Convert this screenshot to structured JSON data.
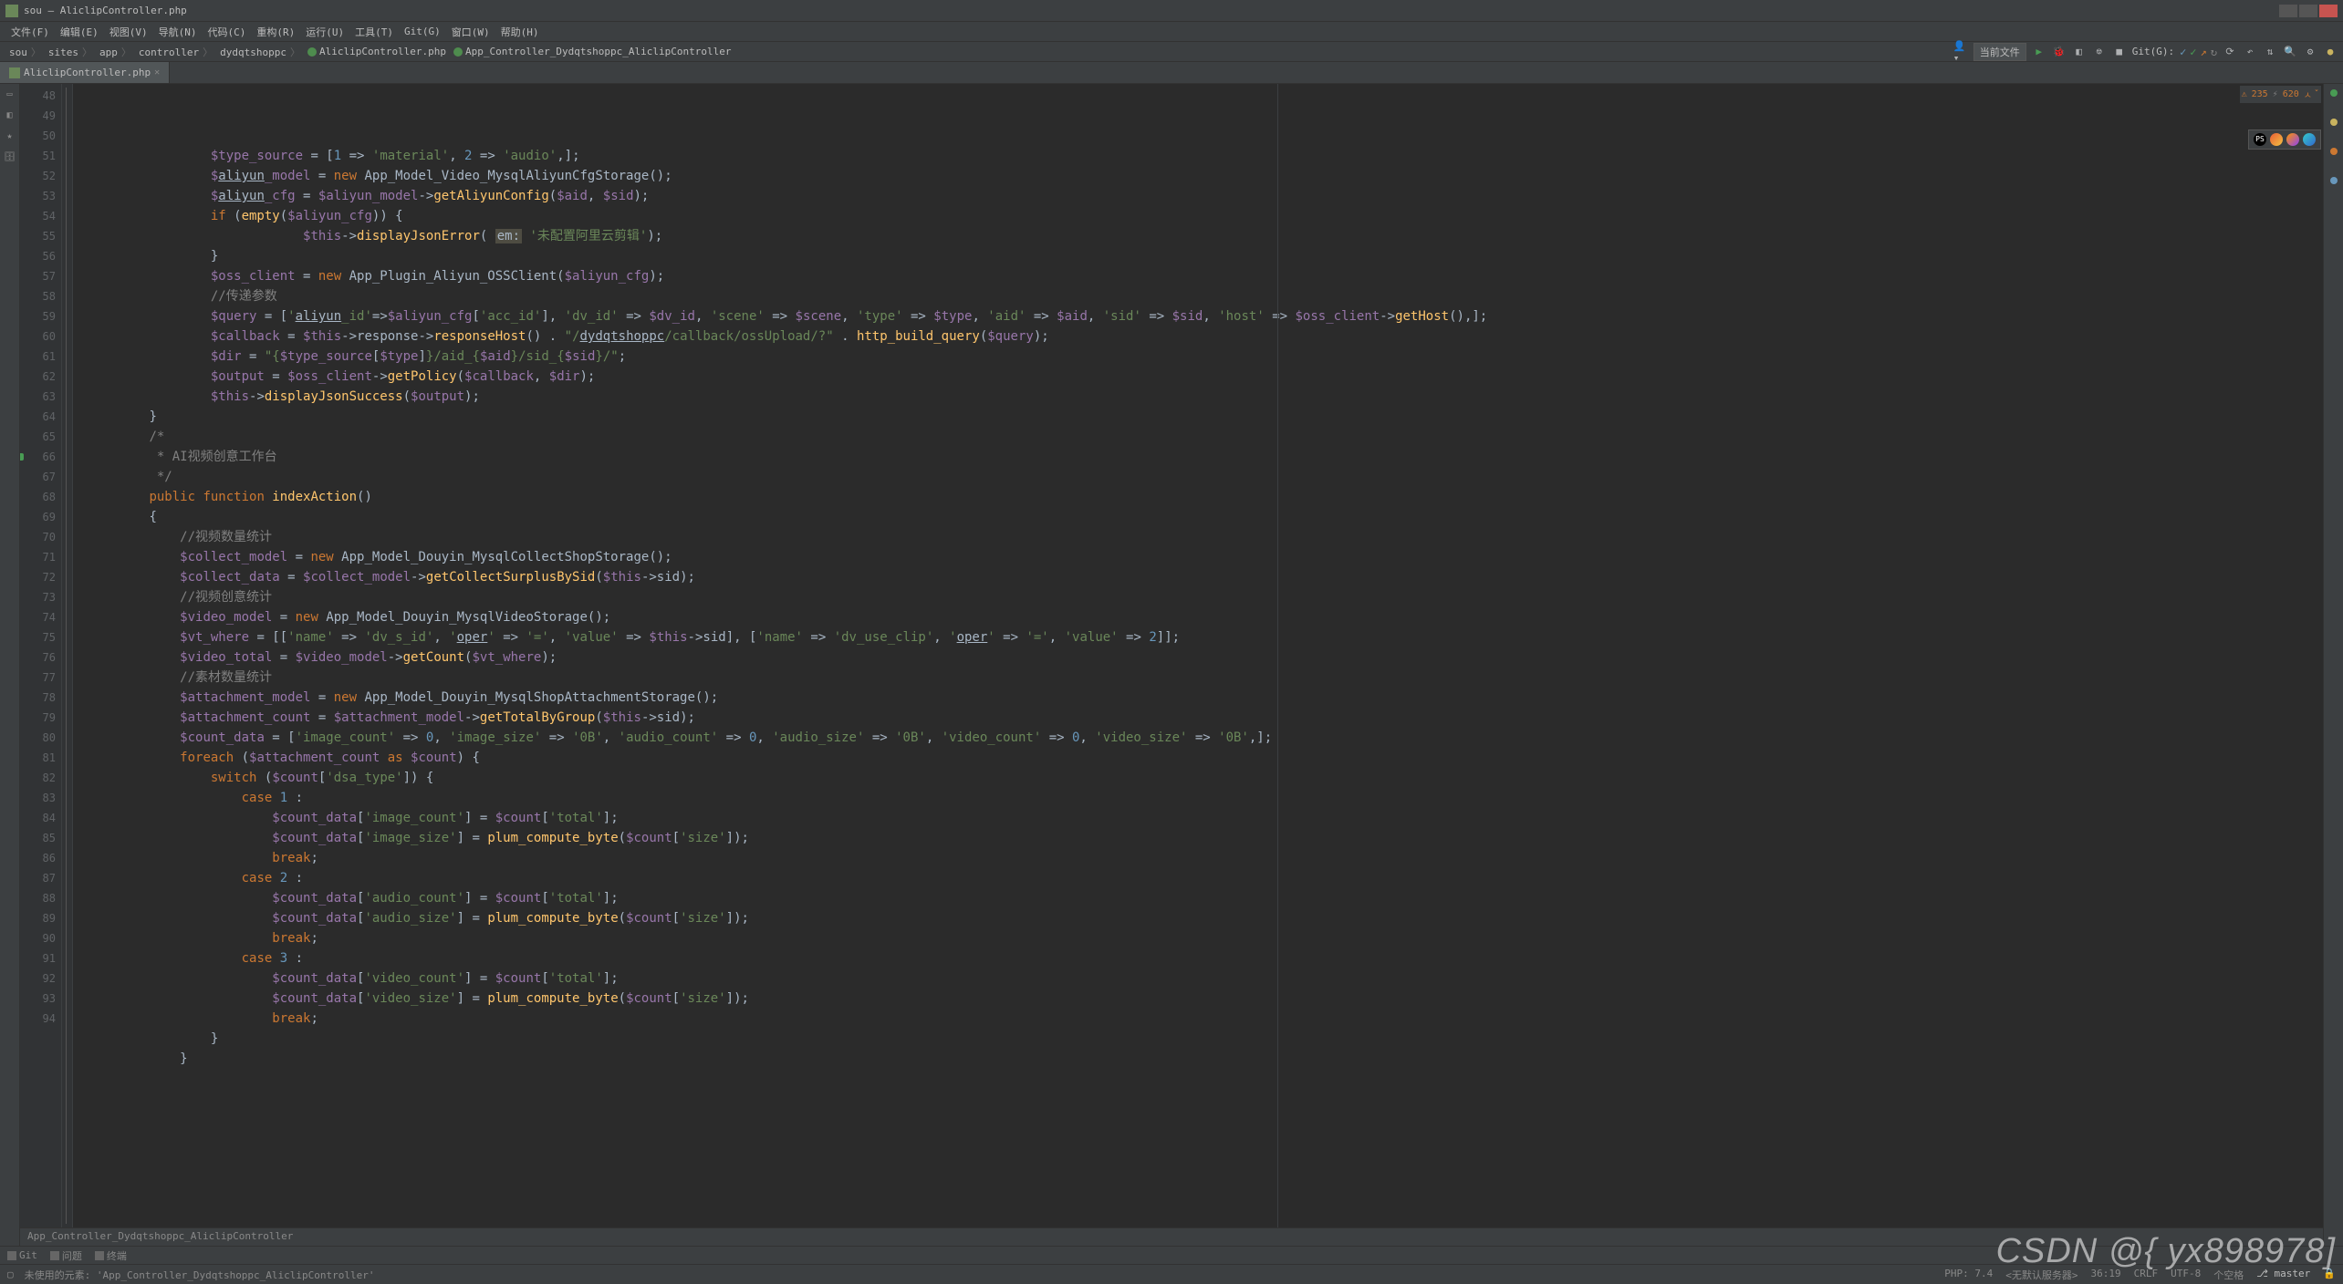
{
  "title": "sou – AliclipController.php",
  "menus": [
    "文件(F)",
    "编辑(E)",
    "视图(V)",
    "导航(N)",
    "代码(C)",
    "重构(R)",
    "运行(U)",
    "工具(T)",
    "Git(G)",
    "窗口(W)",
    "帮助(H)"
  ],
  "crumbs": [
    "sou",
    "sites",
    "app",
    "controller",
    "dydqtshoppc"
  ],
  "crumbFile": "AliclipController.php",
  "crumbClass": "App_Controller_Dydqtshoppc_AliclipController",
  "nav": {
    "config": "当前文件",
    "git": "Git(G):"
  },
  "tab": {
    "label": "AliclipController.php"
  },
  "insp": {
    "warn": "235",
    "hint": "620"
  },
  "lines": {
    "48": [
      [
        "cv",
        "$type_source"
      ],
      [
        "cw",
        " = ["
      ],
      [
        "cn",
        "1"
      ],
      [
        "cw",
        " => "
      ],
      [
        "cs",
        "'material'"
      ],
      [
        "cw",
        ", "
      ],
      [
        "cn",
        "2"
      ],
      [
        "cw",
        " => "
      ],
      [
        "cs",
        "'audio'"
      ],
      [
        "cw",
        ",];"
      ]
    ],
    "49": [
      [
        "cv",
        "$"
      ],
      [
        "cu",
        "aliyun"
      ],
      [
        "cv",
        "_model"
      ],
      [
        "cw",
        " = "
      ],
      [
        "ck",
        "new "
      ],
      [
        "cw",
        "App_Model_Video_MysqlAliyunCfgStorage();"
      ]
    ],
    "50": [
      [
        "cv",
        "$"
      ],
      [
        "cu",
        "aliyun"
      ],
      [
        "cv",
        "_cfg"
      ],
      [
        "cw",
        " = "
      ],
      [
        "cv",
        "$aliyun_model"
      ],
      [
        "cw",
        "->"
      ],
      [
        "cf",
        "getAliyunConfig"
      ],
      [
        "cw",
        "("
      ],
      [
        "cv",
        "$aid"
      ],
      [
        "cw",
        ", "
      ],
      [
        "cv",
        "$sid"
      ],
      [
        "cw",
        ");"
      ]
    ],
    "51": [
      [
        "ck",
        "if"
      ],
      [
        "cw",
        " ("
      ],
      [
        "cf",
        "empty"
      ],
      [
        "cw",
        "("
      ],
      [
        "cv",
        "$aliyun_cfg"
      ],
      [
        "cw",
        ")) {"
      ]
    ],
    "52": [
      [
        "cv",
        "    $this"
      ],
      [
        "cw",
        "->"
      ],
      [
        "cf",
        "displayJsonError"
      ],
      [
        "cw",
        "( "
      ],
      [
        "cb",
        "em:"
      ],
      [
        "cs",
        " '未配置阿里云剪辑'"
      ],
      [
        "cw",
        ");"
      ]
    ],
    "53": [
      [
        "cw",
        "}"
      ]
    ],
    "54": [
      [
        "cv",
        "$oss_client"
      ],
      [
        "cw",
        " = "
      ],
      [
        "ck",
        "new "
      ],
      [
        "cw",
        "App_Plugin_Aliyun_OSSClient("
      ],
      [
        "cv",
        "$aliyun_cfg"
      ],
      [
        "cw",
        ");"
      ]
    ],
    "55": [
      [
        "cc",
        "//传递参数"
      ]
    ],
    "56": [
      [
        "cv",
        "$query"
      ],
      [
        "cw",
        " = ["
      ],
      [
        "cs",
        "'"
      ],
      [
        "cu",
        "aliyun"
      ],
      [
        "cs",
        "_id'"
      ],
      [
        "cw",
        "=>"
      ],
      [
        "cv",
        "$aliyun_cfg"
      ],
      [
        "cw",
        "["
      ],
      [
        "cs",
        "'acc_id'"
      ],
      [
        "cw",
        "], "
      ],
      [
        "cs",
        "'dv_id'"
      ],
      [
        "cw",
        " => "
      ],
      [
        "cv",
        "$dv_id"
      ],
      [
        "cw",
        ", "
      ],
      [
        "cs",
        "'scene'"
      ],
      [
        "cw",
        " => "
      ],
      [
        "cv",
        "$scene"
      ],
      [
        "cw",
        ", "
      ],
      [
        "cs",
        "'type'"
      ],
      [
        "cw",
        " => "
      ],
      [
        "cv",
        "$type"
      ],
      [
        "cw",
        ", "
      ],
      [
        "cs",
        "'aid'"
      ],
      [
        "cw",
        " => "
      ],
      [
        "cv",
        "$aid"
      ],
      [
        "cw",
        ", "
      ],
      [
        "cs",
        "'sid'"
      ],
      [
        "cw",
        " => "
      ],
      [
        "cv",
        "$sid"
      ],
      [
        "cw",
        ", "
      ],
      [
        "cs",
        "'host'"
      ],
      [
        "cw",
        " => "
      ],
      [
        "cv",
        "$oss_client"
      ],
      [
        "cw",
        "->"
      ],
      [
        "cf",
        "getHost"
      ],
      [
        "cw",
        "(),];"
      ]
    ],
    "57": [
      [
        "cv",
        "$callback"
      ],
      [
        "cw",
        " = "
      ],
      [
        "cv",
        "$this"
      ],
      [
        "cw",
        "->response->"
      ],
      [
        "cf",
        "responseHost"
      ],
      [
        "cw",
        "() . "
      ],
      [
        "cs",
        "\"/"
      ],
      [
        "cu",
        "dydqtshoppc"
      ],
      [
        "cs",
        "/callback/ossUpload/?\""
      ],
      [
        "cw",
        " . "
      ],
      [
        "cf",
        "http_build_query"
      ],
      [
        "cw",
        "("
      ],
      [
        "cv",
        "$query"
      ],
      [
        "cw",
        ");"
      ]
    ],
    "58": [
      [
        "cv",
        "$dir"
      ],
      [
        "cw",
        " = "
      ],
      [
        "cs",
        "\"{"
      ],
      [
        "cv",
        "$type_source"
      ],
      [
        "cw",
        "["
      ],
      [
        "cv",
        "$type"
      ],
      [
        "cw",
        "]"
      ],
      [
        "cs",
        "}/aid_{"
      ],
      [
        "cv",
        "$aid"
      ],
      [
        "cs",
        "}/sid_{"
      ],
      [
        "cv",
        "$sid"
      ],
      [
        "cs",
        "}/\""
      ],
      [
        "cw",
        ";"
      ]
    ],
    "59": [
      [
        "cv",
        "$output"
      ],
      [
        "cw",
        " = "
      ],
      [
        "cv",
        "$oss_client"
      ],
      [
        "cw",
        "->"
      ],
      [
        "cf",
        "getPolicy"
      ],
      [
        "cw",
        "("
      ],
      [
        "cv",
        "$callback"
      ],
      [
        "cw",
        ", "
      ],
      [
        "cv",
        "$dir"
      ],
      [
        "cw",
        ");"
      ]
    ],
    "60": [
      [
        "cv",
        "$this"
      ],
      [
        "cw",
        "->"
      ],
      [
        "cf",
        "displayJsonSuccess"
      ],
      [
        "cw",
        "("
      ],
      [
        "cv",
        "$output"
      ],
      [
        "cw",
        ");"
      ]
    ],
    "61": [
      [
        "cw",
        "}"
      ]
    ],
    "62": [
      [
        "cw",
        ""
      ]
    ],
    "63": [
      [
        "cc",
        "/*"
      ]
    ],
    "64": [
      [
        "cc",
        " * AI视频创意工作台"
      ]
    ],
    "65": [
      [
        "cc",
        " */"
      ]
    ],
    "66": [
      [
        "ck",
        "public function "
      ],
      [
        "cf",
        "indexAction"
      ],
      [
        "cw",
        "()"
      ]
    ],
    "67": [
      [
        "cw",
        "{"
      ]
    ],
    "68": [
      [
        "cc",
        "    //视频数量统计"
      ]
    ],
    "69": [
      [
        "cv",
        "    $collect_model"
      ],
      [
        "cw",
        " = "
      ],
      [
        "ck",
        "new "
      ],
      [
        "cw",
        "App_Model_Douyin_MysqlCollectShopStorage();"
      ]
    ],
    "70": [
      [
        "cv",
        "    $collect_data"
      ],
      [
        "cw",
        " = "
      ],
      [
        "cv",
        "$collect_model"
      ],
      [
        "cw",
        "->"
      ],
      [
        "cf",
        "getCollectSurplusBySid"
      ],
      [
        "cw",
        "("
      ],
      [
        "cv",
        "$this"
      ],
      [
        "cw",
        "->sid);"
      ]
    ],
    "71": [
      [
        "cc",
        "    //视频创意统计"
      ]
    ],
    "72": [
      [
        "cv",
        "    $video_model"
      ],
      [
        "cw",
        " = "
      ],
      [
        "ck",
        "new "
      ],
      [
        "cw",
        "App_Model_Douyin_MysqlVideoStorage();"
      ]
    ],
    "73": [
      [
        "cv",
        "    $vt_where"
      ],
      [
        "cw",
        " = [["
      ],
      [
        "cs",
        "'name'"
      ],
      [
        "cw",
        " => "
      ],
      [
        "cs",
        "'dv_s_id'"
      ],
      [
        "cw",
        ", "
      ],
      [
        "cs",
        "'"
      ],
      [
        "cu",
        "oper"
      ],
      [
        "cs",
        "'"
      ],
      [
        "cw",
        " => "
      ],
      [
        "cs",
        "'='"
      ],
      [
        "cw",
        ", "
      ],
      [
        "cs",
        "'value'"
      ],
      [
        "cw",
        " => "
      ],
      [
        "cv",
        "$this"
      ],
      [
        "cw",
        "->sid], ["
      ],
      [
        "cs",
        "'name'"
      ],
      [
        "cw",
        " => "
      ],
      [
        "cs",
        "'dv_use_clip'"
      ],
      [
        "cw",
        ", "
      ],
      [
        "cs",
        "'"
      ],
      [
        "cu",
        "oper"
      ],
      [
        "cs",
        "'"
      ],
      [
        "cw",
        " => "
      ],
      [
        "cs",
        "'='"
      ],
      [
        "cw",
        ", "
      ],
      [
        "cs",
        "'value'"
      ],
      [
        "cw",
        " => "
      ],
      [
        "cn",
        "2"
      ],
      [
        "cw",
        "]];"
      ]
    ],
    "74": [
      [
        "cv",
        "    $video_total"
      ],
      [
        "cw",
        " = "
      ],
      [
        "cv",
        "$video_model"
      ],
      [
        "cw",
        "->"
      ],
      [
        "cf",
        "getCount"
      ],
      [
        "cw",
        "("
      ],
      [
        "cv",
        "$vt_where"
      ],
      [
        "cw",
        ");"
      ]
    ],
    "75": [
      [
        "cc",
        "    //素材数量统计"
      ]
    ],
    "76": [
      [
        "cv",
        "    $attachment_model"
      ],
      [
        "cw",
        " = "
      ],
      [
        "ck",
        "new "
      ],
      [
        "cw",
        "App_Model_Douyin_MysqlShopAttachmentStorage();"
      ]
    ],
    "77": [
      [
        "cv",
        "    $attachment_count"
      ],
      [
        "cw",
        " = "
      ],
      [
        "cv",
        "$attachment_model"
      ],
      [
        "cw",
        "->"
      ],
      [
        "cf",
        "getTotalByGroup"
      ],
      [
        "cw",
        "("
      ],
      [
        "cv",
        "$this"
      ],
      [
        "cw",
        "->sid);"
      ]
    ],
    "78": [
      [
        "cv",
        "    $count_data"
      ],
      [
        "cw",
        " = ["
      ],
      [
        "cs",
        "'image_count'"
      ],
      [
        "cw",
        " => "
      ],
      [
        "cn",
        "0"
      ],
      [
        "cw",
        ", "
      ],
      [
        "cs",
        "'image_size'"
      ],
      [
        "cw",
        " => "
      ],
      [
        "cs",
        "'0B'"
      ],
      [
        "cw",
        ", "
      ],
      [
        "cs",
        "'audio_count'"
      ],
      [
        "cw",
        " => "
      ],
      [
        "cn",
        "0"
      ],
      [
        "cw",
        ", "
      ],
      [
        "cs",
        "'audio_size'"
      ],
      [
        "cw",
        " => "
      ],
      [
        "cs",
        "'0B'"
      ],
      [
        "cw",
        ", "
      ],
      [
        "cs",
        "'video_count'"
      ],
      [
        "cw",
        " => "
      ],
      [
        "cn",
        "0"
      ],
      [
        "cw",
        ", "
      ],
      [
        "cs",
        "'video_size'"
      ],
      [
        "cw",
        " => "
      ],
      [
        "cs",
        "'0B'"
      ],
      [
        "cw",
        ",];"
      ]
    ],
    "79": [
      [
        "ck",
        "    foreach "
      ],
      [
        "cw",
        "("
      ],
      [
        "cv",
        "$attachment_count"
      ],
      [
        "ck",
        " as "
      ],
      [
        "cv",
        "$count"
      ],
      [
        "cw",
        ") {"
      ]
    ],
    "80": [
      [
        "ck",
        "        switch "
      ],
      [
        "cw",
        "("
      ],
      [
        "cv",
        "$count"
      ],
      [
        "cw",
        "["
      ],
      [
        "cs",
        "'dsa_type'"
      ],
      [
        "cw",
        "]) {"
      ]
    ],
    "81": [
      [
        "ck",
        "            case "
      ],
      [
        "cn",
        "1"
      ],
      [
        "cw",
        " :"
      ]
    ],
    "82": [
      [
        "cv",
        "                $count_data"
      ],
      [
        "cw",
        "["
      ],
      [
        "cs",
        "'image_count'"
      ],
      [
        "cw",
        "] = "
      ],
      [
        "cv",
        "$count"
      ],
      [
        "cw",
        "["
      ],
      [
        "cs",
        "'total'"
      ],
      [
        "cw",
        "];"
      ]
    ],
    "83": [
      [
        "cv",
        "                $count_data"
      ],
      [
        "cw",
        "["
      ],
      [
        "cs",
        "'image_size'"
      ],
      [
        "cw",
        "] = "
      ],
      [
        "cf",
        "plum_compute_byte"
      ],
      [
        "cw",
        "("
      ],
      [
        "cv",
        "$count"
      ],
      [
        "cw",
        "["
      ],
      [
        "cs",
        "'size'"
      ],
      [
        "cw",
        "]);"
      ]
    ],
    "84": [
      [
        "ck",
        "                break"
      ],
      [
        "cw",
        ";"
      ]
    ],
    "85": [
      [
        "ck",
        "            case "
      ],
      [
        "cn",
        "2"
      ],
      [
        "cw",
        " :"
      ]
    ],
    "86": [
      [
        "cv",
        "                $count_data"
      ],
      [
        "cw",
        "["
      ],
      [
        "cs",
        "'audio_count'"
      ],
      [
        "cw",
        "] = "
      ],
      [
        "cv",
        "$count"
      ],
      [
        "cw",
        "["
      ],
      [
        "cs",
        "'total'"
      ],
      [
        "cw",
        "];"
      ]
    ],
    "87": [
      [
        "cv",
        "                $count_data"
      ],
      [
        "cw",
        "["
      ],
      [
        "cs",
        "'audio_size'"
      ],
      [
        "cw",
        "] = "
      ],
      [
        "cf",
        "plum_compute_byte"
      ],
      [
        "cw",
        "("
      ],
      [
        "cv",
        "$count"
      ],
      [
        "cw",
        "["
      ],
      [
        "cs",
        "'size'"
      ],
      [
        "cw",
        "]);"
      ]
    ],
    "88": [
      [
        "ck",
        "                break"
      ],
      [
        "cw",
        ";"
      ]
    ],
    "89": [
      [
        "ck",
        "            case "
      ],
      [
        "cn",
        "3"
      ],
      [
        "cw",
        " :"
      ]
    ],
    "90": [
      [
        "cv",
        "                $count_data"
      ],
      [
        "cw",
        "["
      ],
      [
        "cs",
        "'video_count'"
      ],
      [
        "cw",
        "] = "
      ],
      [
        "cv",
        "$count"
      ],
      [
        "cw",
        "["
      ],
      [
        "cs",
        "'total'"
      ],
      [
        "cw",
        "];"
      ]
    ],
    "91": [
      [
        "cv",
        "                $count_data"
      ],
      [
        "cw",
        "["
      ],
      [
        "cs",
        "'video_size'"
      ],
      [
        "cw",
        "] = "
      ],
      [
        "cf",
        "plum_compute_byte"
      ],
      [
        "cw",
        "("
      ],
      [
        "cv",
        "$count"
      ],
      [
        "cw",
        "["
      ],
      [
        "cs",
        "'size'"
      ],
      [
        "cw",
        "]);"
      ]
    ],
    "92": [
      [
        "ck",
        "                break"
      ],
      [
        "cw",
        ";"
      ]
    ],
    "93": [
      [
        "cw",
        "        }"
      ]
    ],
    "94": [
      [
        "cw",
        "    }"
      ]
    ]
  },
  "indents": {
    "48": 8,
    "49": 8,
    "50": 8,
    "51": 8,
    "52": 12,
    "53": 8,
    "54": 8,
    "55": 8,
    "56": 8,
    "57": 8,
    "58": 8,
    "59": 8,
    "60": 8,
    "61": 4,
    "62": 0,
    "63": 4,
    "64": 4,
    "65": 4,
    "66": 4,
    "67": 4,
    "68": 4,
    "69": 4,
    "70": 4,
    "71": 4,
    "72": 4,
    "73": 4,
    "74": 4,
    "75": 4,
    "76": 4,
    "77": 4,
    "78": 4,
    "79": 4,
    "80": 4,
    "81": 4,
    "82": 4,
    "83": 4,
    "84": 4,
    "85": 4,
    "86": 4,
    "87": 4,
    "88": 4,
    "89": 4,
    "90": 4,
    "91": 4,
    "92": 4,
    "93": 4,
    "94": 4
  },
  "botCrumb": "App_Controller_Dydqtshoppc_AliclipController",
  "btw": [
    "Git",
    "问题",
    "终端"
  ],
  "status": {
    "msg": "未使用的元素: 'App_Controller_Dydqtshoppc_AliclipController'",
    "php": "PHP: 7.4",
    "server": "<无默认服务器>",
    "pos": "36:19",
    "crlf": "CRLF",
    "enc": "UTF-8",
    "spaces": "个空格",
    "branch": "master"
  },
  "watermark": "CSDN @{ yx898978]"
}
